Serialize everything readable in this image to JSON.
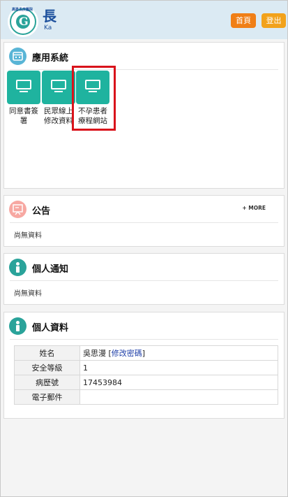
{
  "header": {
    "logo_arc_text": "高雄長庚醫院",
    "logo_mark": "G",
    "brand_glyph": "長",
    "brand_sub": "Ka",
    "home_label": "首頁",
    "logout_label": "登出",
    "colors": {
      "home": "#f07f17",
      "logout": "#f2a21b",
      "accent": "#1fb39f"
    }
  },
  "apps": {
    "title": "應用系統",
    "icon": "calendar-icon",
    "items": [
      {
        "label": "同意書簽署",
        "icon": "monitor-icon"
      },
      {
        "label": "民眾線上修改資料",
        "icon": "monitor-icon"
      },
      {
        "label": "不孕患者療程網站",
        "icon": "monitor-icon",
        "highlighted": true,
        "overflow": "....."
      }
    ]
  },
  "notice": {
    "title": "公告",
    "icon": "announcement-icon",
    "more_label": "+ MORE",
    "empty_text": "尚無資料"
  },
  "notify": {
    "title": "個人通知",
    "icon": "info-icon",
    "empty_text": "尚無資料"
  },
  "profile": {
    "title": "個人資料",
    "icon": "info-icon",
    "rows": [
      {
        "key": "姓名",
        "value": "吳思漫",
        "link_open": " [",
        "link": "修改密碼",
        "link_close": "]"
      },
      {
        "key": "安全等級",
        "value": "1"
      },
      {
        "key": "病歷號",
        "value": "17453984"
      },
      {
        "key": "電子郵件",
        "value": ""
      }
    ]
  }
}
